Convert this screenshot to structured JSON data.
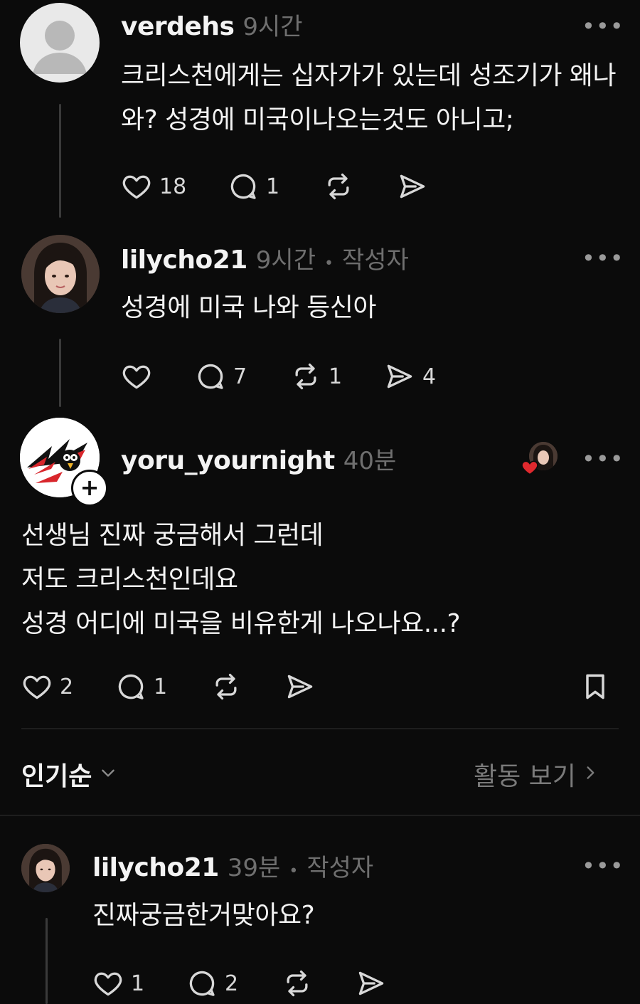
{
  "colors": {
    "background": "#0b0b0b",
    "text": "#f3f3f3",
    "muted": "#6f6f6f",
    "heart_red": "#e0292e"
  },
  "posts": [
    {
      "username": "verdehs",
      "time": "9시간",
      "author_tag": "",
      "text": "크리스천에게는 십자가가 있는데 성조기가 왜나와? 성경에 미국이나오는것도 아니고;",
      "likes": "18",
      "replies": "1",
      "reposts": "",
      "shares": ""
    },
    {
      "username": "lilycho21",
      "time": "9시간",
      "author_tag": "작성자",
      "text": "성경에 미국 나와 등신아",
      "likes": "",
      "replies": "7",
      "reposts": "1",
      "shares": "4"
    },
    {
      "username": "yoru_yournight",
      "time": "40분",
      "author_tag": "",
      "text_lines": [
        "선생님 진짜 궁금해서 그런데",
        "저도 크리스천인데요",
        "성경 어디에 미국을 비유한게 나오나요...?"
      ],
      "likes": "2",
      "replies": "1",
      "reposts": "",
      "shares": ""
    }
  ],
  "sort_bar": {
    "sort_label": "인기순",
    "activity_label": "활동 보기"
  },
  "reply": {
    "username": "lilycho21",
    "time": "39분",
    "author_tag": "작성자",
    "text": "진짜궁금한거맞아요?",
    "likes": "1",
    "replies": "2"
  },
  "glyphs": {
    "more": "•••",
    "dot": "•",
    "plus": "+",
    "chevron_down": "⌄",
    "chevron_right": "›"
  }
}
